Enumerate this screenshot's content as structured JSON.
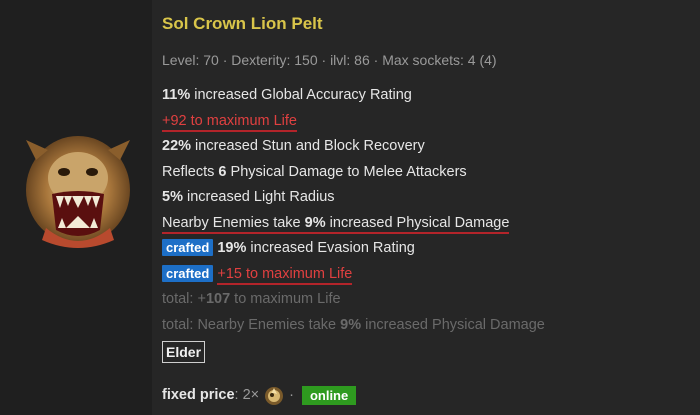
{
  "item": {
    "name": "Sol Crown Lion Pelt",
    "meta": "Level: 70 · Dexterity: 150 · ilvl: 86 · Max sockets: 4 (4)",
    "icon": "lion-pelt-icon"
  },
  "mods": [
    {
      "value": "11%",
      "text": " increased Global Accuracy Rating"
    },
    {
      "text": "+92 to maximum Life"
    },
    {
      "value": "22%",
      "text": " increased Stun and Block Recovery"
    },
    {
      "pre": "Reflects ",
      "value": "6",
      "text": " Physical Damage to Melee Attackers"
    },
    {
      "value": "5%",
      "text": " increased Light Radius"
    },
    {
      "pre": "Nearby Enemies take ",
      "value": "9%",
      "text": " increased Physical Damage"
    },
    {
      "tag": "crafted",
      "value": "19%",
      "text": " increased Evasion Rating"
    },
    {
      "tag": "crafted",
      "text": "+15 to maximum Life"
    },
    {
      "pre": "total: +",
      "value": "107",
      "text": " to maximum Life"
    },
    {
      "pre": "total: Nearby Enemies take ",
      "value": "9%",
      "text": " increased Physical Damage"
    }
  ],
  "influence": "Elder",
  "price": {
    "label": "fixed price",
    "sep": ":",
    "amount": "2×",
    "currency_icon": "exalted-orb-icon",
    "dot": "·",
    "status": "online"
  },
  "colors": {
    "title": "#d9c54a",
    "life_red": "#e04040",
    "underline": "#b3242a",
    "crafted_tag": "#1d6fc7",
    "online": "#2e9a1f"
  }
}
